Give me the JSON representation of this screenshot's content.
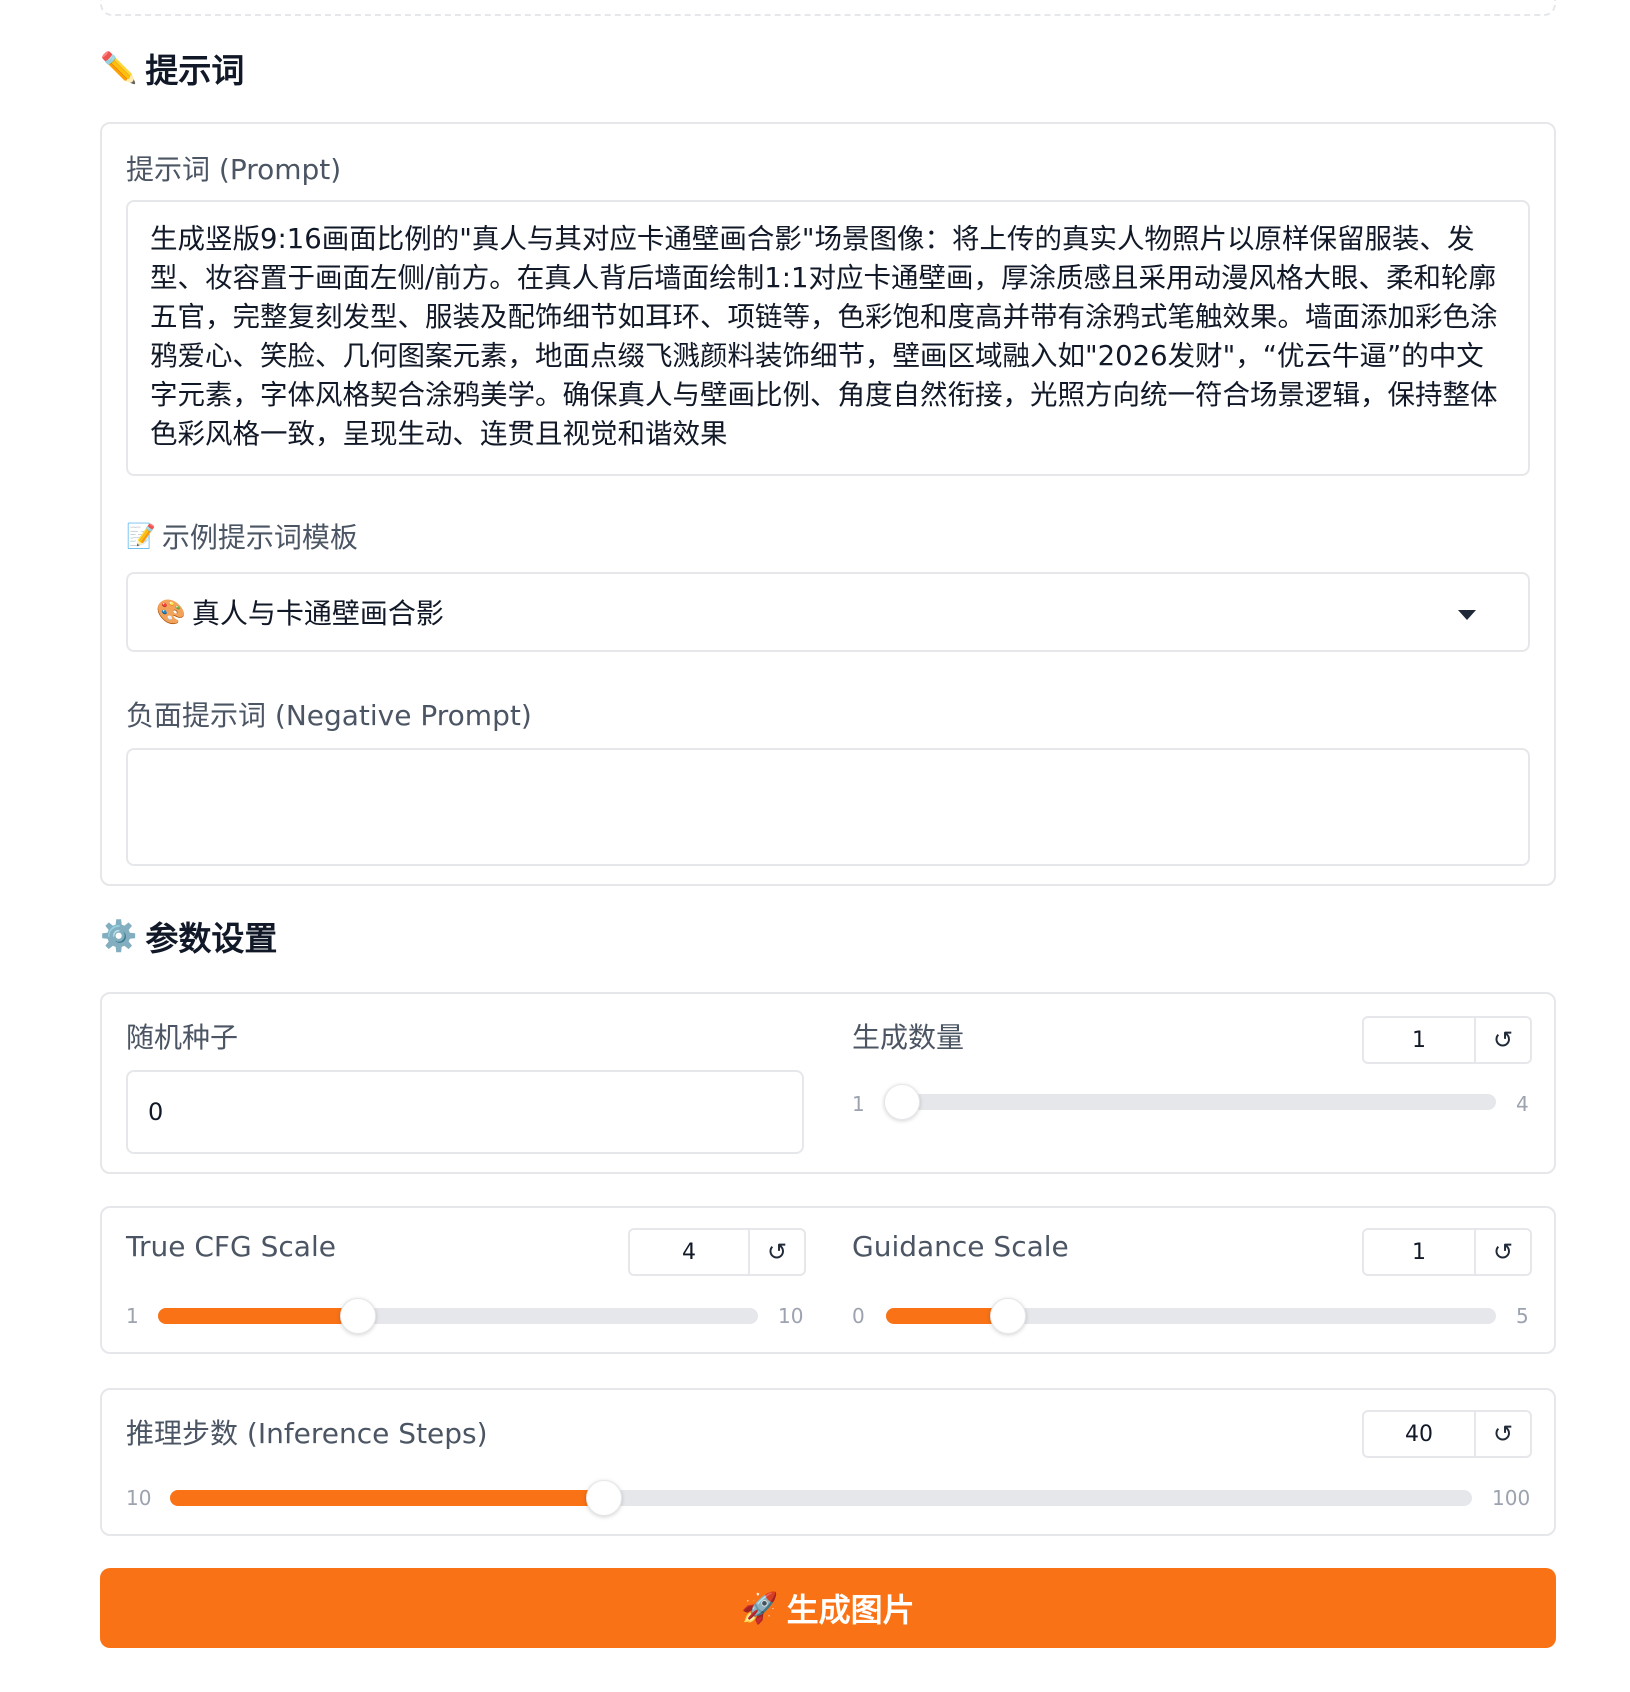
{
  "prompt_section": {
    "icon": "pencil-icon",
    "title": "提示词",
    "prompt_label": "提示词 (Prompt)",
    "prompt_value": "生成竖版9:16画面比例的\"真人与其对应卡通壁画合影\"场景图像：将上传的真实人物照片以原样保留服装、发型、妆容置于画面左侧/前方。在真人背后墙面绘制1:1对应卡通壁画，厚涂质感且采用动漫风格大眼、柔和轮廓五官，完整复刻发型、服装及配饰细节如耳环、项链等，色彩饱和度高并带有涂鸦式笔触效果。墙面添加彩色涂鸦爱心、笑脸、几何图案元素，地面点缀飞溅颜料装饰细节，壁画区域融入如\"2026发财\"，“优云牛逼”的中文字元素，字体风格契合涂鸦美学。确保真人与壁画比例、角度自然衔接，光照方向统一符合场景逻辑，保持整体色彩风格一致，呈现生动、连贯且视觉和谐效果",
    "template_icon": "memo-icon",
    "template_label": "示例提示词模板",
    "template_selected_icon": "palette-icon",
    "template_selected": "真人与卡通壁画合影",
    "negative_label": "负面提示词 (Negative Prompt)",
    "negative_value": ""
  },
  "params_section": {
    "icon": "gear-icon",
    "title": "参数设置",
    "seed": {
      "label": "随机种子",
      "value": "0"
    },
    "num_images": {
      "label": "生成数量",
      "value": 1,
      "min": 1,
      "max": 4
    },
    "true_cfg": {
      "label": "True CFG Scale",
      "value": 4,
      "min": 1,
      "max": 10
    },
    "guidance": {
      "label": "Guidance Scale",
      "value": 1,
      "min": 0,
      "max": 5
    },
    "steps": {
      "label": "推理步数 (Inference Steps)",
      "value": 40,
      "min": 10,
      "max": 100
    },
    "reset_icon": "reset-icon"
  },
  "generate_button": {
    "icon": "rocket-icon",
    "label": "生成图片"
  },
  "colors": {
    "accent": "#f97316",
    "track": "#e5e7eb",
    "border": "#e5e7eb"
  }
}
